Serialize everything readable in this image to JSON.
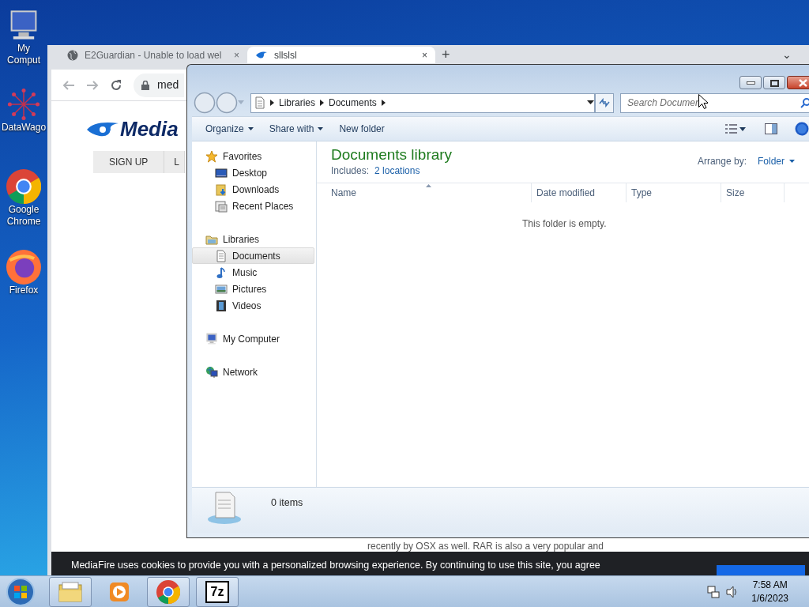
{
  "desktop": {
    "icons": [
      {
        "kind": "computer",
        "label": "My Comput"
      },
      {
        "kind": "datawagon",
        "label": "DataWago"
      },
      {
        "kind": "chrome",
        "label": "Google Chrome"
      },
      {
        "kind": "firefox",
        "label": "Firefox"
      }
    ]
  },
  "browser": {
    "tabs": [
      {
        "title": "E2Guardian - Unable to load wel",
        "close": "×",
        "selected": false
      },
      {
        "title": "sllslsl",
        "close": "×",
        "selected": true
      }
    ],
    "new_tab": "+",
    "tab_menu": "⌄",
    "address": "med",
    "page": {
      "logo_text": "Media",
      "buttons": [
        "SIGN UP",
        "L"
      ],
      "body_text": "recently by OSX as well. RAR is also a very popular and",
      "cookie_text": "MediaFire uses cookies to provide you with a personalized browsing experience. By continuing to use this site, you agree"
    }
  },
  "explorer": {
    "breadcrumb": [
      "Libraries",
      "Documents"
    ],
    "search": {
      "placeholder": "Search Documen"
    },
    "commands": [
      {
        "label": "Organize",
        "dropdown": true
      },
      {
        "label": "Share with",
        "dropdown": true
      },
      {
        "label": "New folder",
        "dropdown": false
      }
    ],
    "nav": [
      {
        "kind": "star",
        "label": "Favorites",
        "selected": false,
        "children": [
          {
            "kind": "desktop",
            "label": "Desktop",
            "selected": false
          },
          {
            "kind": "downloads",
            "label": "Downloads",
            "selected": false
          },
          {
            "kind": "recent",
            "label": "Recent Places",
            "selected": false
          }
        ]
      },
      {
        "kind": "library",
        "label": "Libraries",
        "selected": false,
        "children": [
          {
            "kind": "document",
            "label": "Documents",
            "selected": true
          },
          {
            "kind": "music",
            "label": "Music",
            "selected": false
          },
          {
            "kind": "pictures",
            "label": "Pictures",
            "selected": false
          },
          {
            "kind": "videos",
            "label": "Videos",
            "selected": false
          }
        ]
      },
      {
        "kind": "computer",
        "label": "My Computer",
        "selected": false
      },
      {
        "kind": "network",
        "label": "Network",
        "selected": false
      }
    ],
    "library": {
      "title": "Documents library",
      "includes_label": "Includes:",
      "includes_link": "2 locations",
      "arrange_label": "Arrange by:",
      "arrange_value": "Folder"
    },
    "columns": [
      {
        "label": "Name",
        "sorted": true
      },
      {
        "label": "Date modified",
        "sorted": false
      },
      {
        "label": "Type",
        "sorted": false
      },
      {
        "label": "Size",
        "sorted": false
      }
    ],
    "empty_message": "This folder is empty.",
    "status": "0 items"
  },
  "taskbar": {
    "apps": [
      {
        "kind": "explorer",
        "running": true
      },
      {
        "kind": "media",
        "running": false
      },
      {
        "kind": "chrome",
        "running": true
      },
      {
        "kind": "sevenzip",
        "label": "7z",
        "running": true
      }
    ],
    "time": "7:58 AM",
    "date": "1/6/2023"
  }
}
